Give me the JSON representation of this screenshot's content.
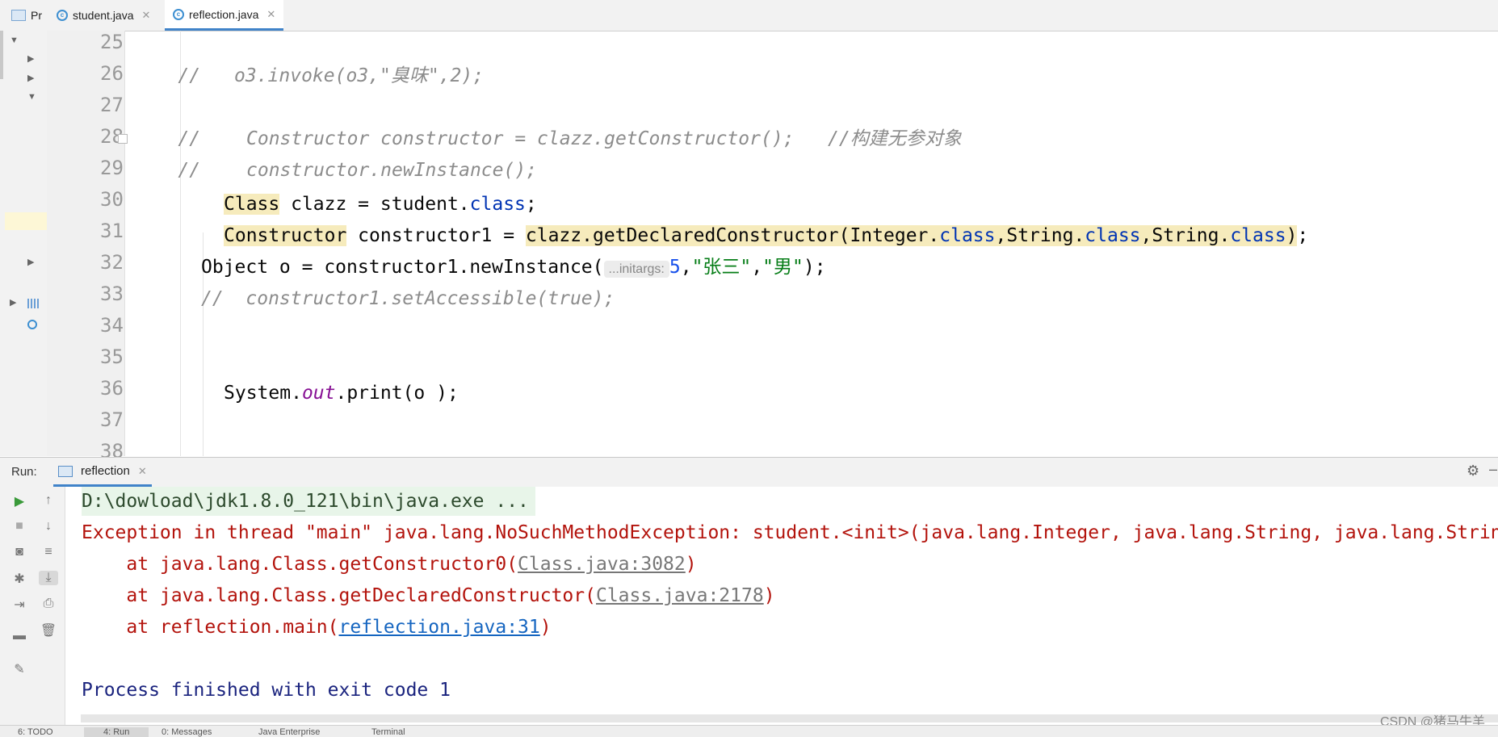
{
  "tabs": [
    {
      "label": "Pr",
      "icon": "project-view-icon"
    },
    {
      "label": "student.java",
      "icon": "java-class-icon"
    },
    {
      "label": "reflection.java",
      "icon": "java-class-icon",
      "active": true
    }
  ],
  "editor": {
    "line_numbers": [
      "25",
      "26",
      "27",
      "28",
      "29",
      "30",
      "31",
      "32",
      "33",
      "34",
      "35",
      "36",
      "37",
      "38"
    ],
    "lines": {
      "l25_comment": "//",
      "l25_text": "o3.invoke(o3,\"臭味\",2);",
      "l27_comment": "//",
      "l27_text": "Constructor constructor = clazz.getConstructor();   //构建无参对象",
      "l28_comment": "//",
      "l28_text": "constructor.newInstance();",
      "l30": {
        "t1": "Class",
        "t2": " clazz = student.",
        "t3": "class",
        "t4": ";"
      },
      "l31": {
        "t1": "Constructor",
        "t2": " constructor1 = ",
        "t3": "clazz.getDeclaredConstructor(Integer.",
        "t4": "class",
        "t5": ",String.",
        "t6": "class",
        "t7": ",String.",
        "t8": "class",
        "t9": ")",
        "t10": ";"
      },
      "l32": {
        "t1": "Object o = constructor1.newInstance(",
        "hint": "...initargs:",
        "t2": "5",
        "t3": ",",
        "t4": "\"张三\"",
        "t5": ",",
        "t6": "\"男\"",
        "t7": ");"
      },
      "l33": "//  constructor1.setAccessible(true);",
      "l36": {
        "t1": "System.",
        "t2": "out",
        "t3": ".print(o );"
      }
    }
  },
  "run": {
    "title": "Run:",
    "tab": "reflection",
    "console": {
      "cmd": "D:\\dowload\\jdk1.8.0_121\\bin\\java.exe ...",
      "exception": "Exception in thread \"main\" java.lang.NoSuchMethodException: student.<init>(java.lang.Integer, java.lang.String, java.lang.String)",
      "at1_prefix": "    at java.lang.Class.getConstructor0(",
      "at1_link": "Class.java:3082",
      "at1_suffix": ")",
      "at2_prefix": "    at java.lang.Class.getDeclaredConstructor(",
      "at2_link": "Class.java:2178",
      "at2_suffix": ")",
      "at3_prefix": "    at reflection.main(",
      "at3_link": "reflection.java:31",
      "at3_suffix": ")",
      "finished": "Process finished with exit code 1"
    }
  },
  "bottom_bar": {
    "todo": "6: TODO",
    "run": "4: Run",
    "messages": "0: Messages",
    "java_enterprise": "Java Enterprise",
    "terminal": "Terminal"
  },
  "watermark": "CSDN @猪马牛羊"
}
